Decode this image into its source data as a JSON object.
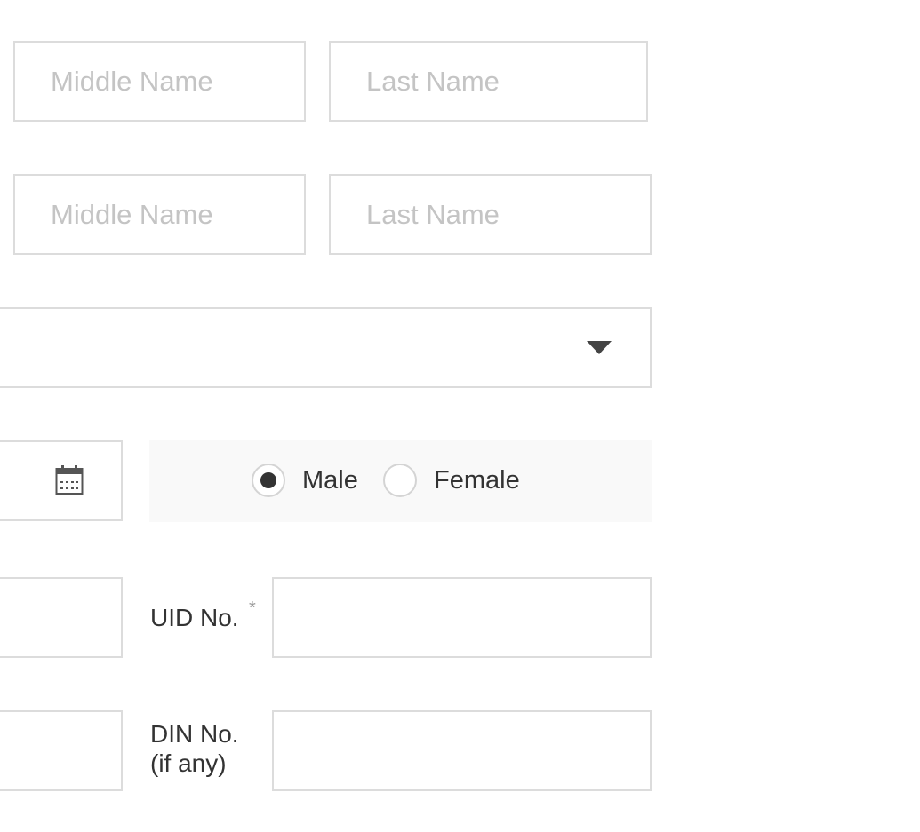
{
  "name_row_1": {
    "middle_name_placeholder": "Middle Name",
    "last_name_placeholder": "Last Name"
  },
  "name_row_2": {
    "middle_name_placeholder": "Middle Name",
    "last_name_placeholder": "Last Name"
  },
  "dropdown": {
    "selected_value": "",
    "icon": "caret-down-icon"
  },
  "date_field": {
    "value": "",
    "icon": "calendar-icon"
  },
  "gender": {
    "options": [
      "Male",
      "Female"
    ],
    "selected": "Male"
  },
  "uid": {
    "label": "UID No.",
    "required_marker": "*",
    "value": ""
  },
  "din": {
    "label_line1": "DIN No.",
    "label_line2": "(if any)",
    "value": ""
  },
  "colors": {
    "border": "#dcdcdc",
    "placeholder": "#c4c4c4",
    "text": "#333333",
    "panel_background": "#f9f9f9"
  }
}
